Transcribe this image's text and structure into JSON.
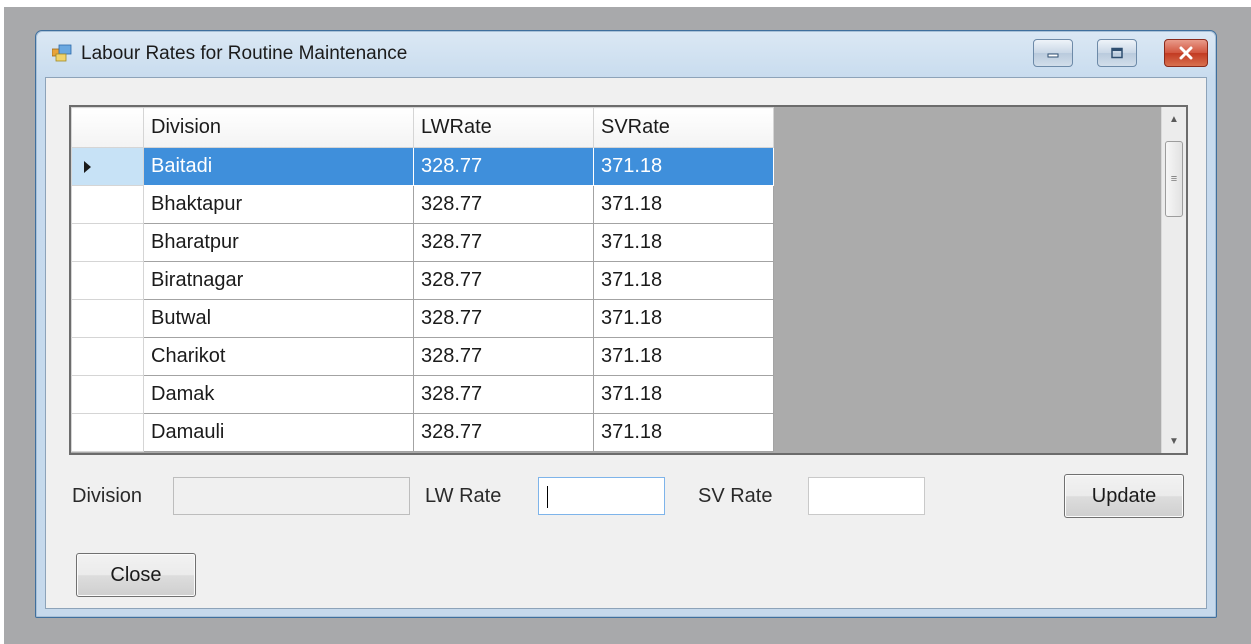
{
  "window": {
    "title": "Labour Rates for Routine Maintenance"
  },
  "grid": {
    "columns": [
      "Division",
      "LWRate",
      "SVRate"
    ],
    "rows": [
      {
        "division": "Baitadi",
        "lw": "328.77",
        "sv": "371.18"
      },
      {
        "division": "Bhaktapur",
        "lw": "328.77",
        "sv": "371.18"
      },
      {
        "division": "Bharatpur",
        "lw": "328.77",
        "sv": "371.18"
      },
      {
        "division": "Biratnagar",
        "lw": "328.77",
        "sv": "371.18"
      },
      {
        "division": "Butwal",
        "lw": "328.77",
        "sv": "371.18"
      },
      {
        "division": "Charikot",
        "lw": "328.77",
        "sv": "371.18"
      },
      {
        "division": "Damak",
        "lw": "328.77",
        "sv": "371.18"
      },
      {
        "division": "Damauli",
        "lw": "328.77",
        "sv": "371.18"
      }
    ],
    "selected_row": 0
  },
  "form": {
    "division_label": "Division",
    "division_value": "",
    "lw_rate_label": "LW Rate",
    "lw_rate_value": "",
    "sv_rate_label": "SV Rate",
    "sv_rate_value": "",
    "update_label": "Update",
    "close_label": "Close"
  }
}
